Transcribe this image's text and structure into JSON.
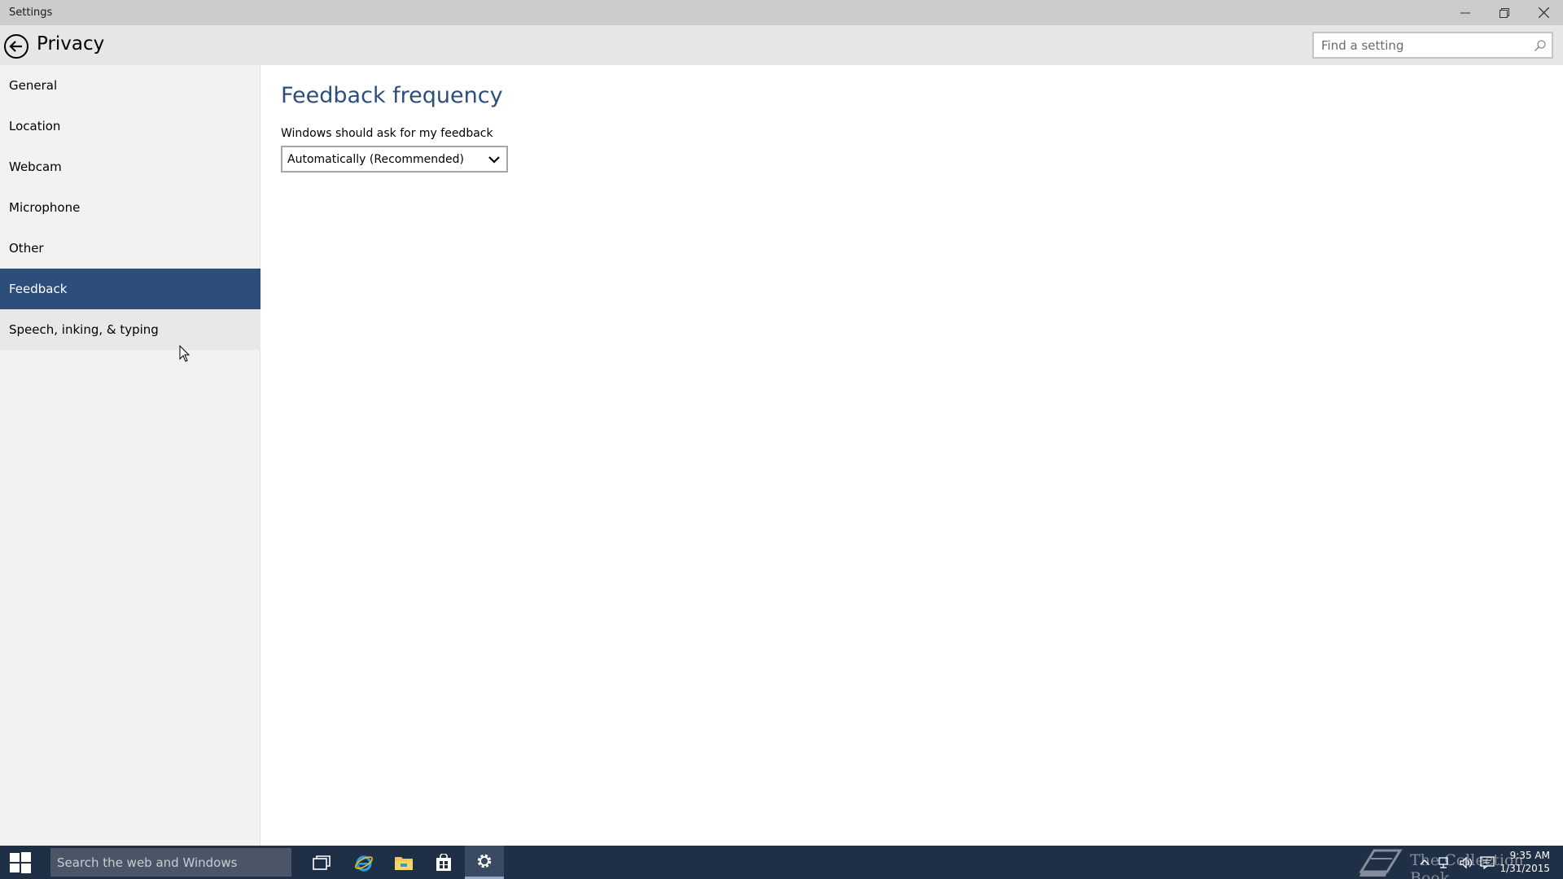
{
  "window": {
    "title": "Settings",
    "controls": {
      "minimize": "minimize-icon",
      "restore": "restore-icon",
      "close": "close-icon"
    }
  },
  "header": {
    "title": "Privacy",
    "search_placeholder": "Find a setting"
  },
  "sidebar": {
    "items": [
      {
        "label": "General"
      },
      {
        "label": "Location"
      },
      {
        "label": "Webcam"
      },
      {
        "label": "Microphone"
      },
      {
        "label": "Other"
      },
      {
        "label": "Feedback",
        "selected": true
      },
      {
        "label": "Speech, inking, & typing"
      }
    ]
  },
  "content": {
    "section_title": "Feedback frequency",
    "field_label": "Windows should ask for my feedback",
    "dropdown_value": "Automatically (Recommended)"
  },
  "taskbar": {
    "search_placeholder": "Search the web and Windows",
    "watermark": "The Collection Book",
    "clock_time": "9:35 AM",
    "clock_date": "1/31/2015"
  },
  "colors": {
    "accent": "#2d4e7b",
    "titlebar": "#cccccc",
    "header": "#e6e6e6",
    "sidebar": "#f2f2f2",
    "taskbar": "#1f2f45"
  }
}
